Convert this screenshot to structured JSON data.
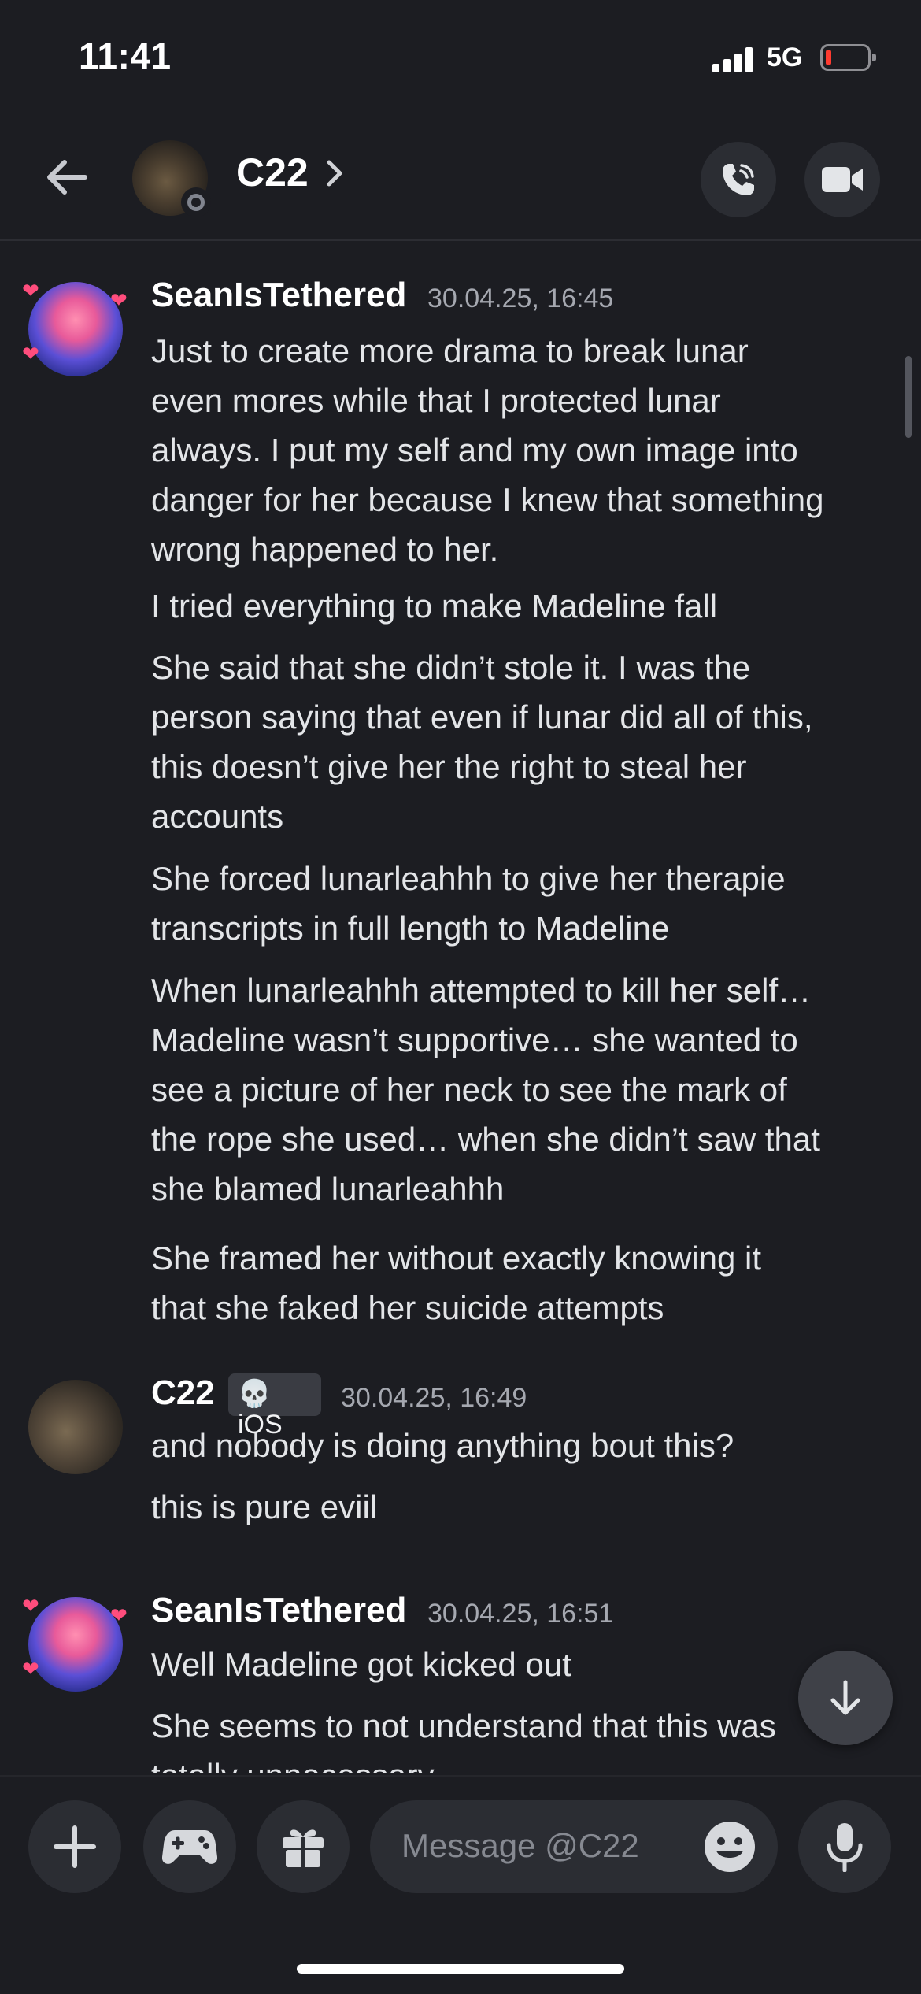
{
  "status_bar": {
    "time": "11:41",
    "network": "5G"
  },
  "header": {
    "contact_name": "C22"
  },
  "messages": [
    {
      "author": "SeanIsTethered",
      "timestamp": "30.04.25, 16:45",
      "lines": [
        "Just to create more drama to break lunar\neven mores while that I protected lunar\nalways. I put my self and my own image into\ndanger for her because I knew that something\nwrong happened to her.",
        "I tried everything to make Madeline fall",
        "She said that she didn’t stole it. I was the\nperson saying that even if lunar did all of this,\nthis doesn’t give her the right to steal her\naccounts",
        "She forced lunarleahhh to give her therapie\ntranscripts in full length to Madeline",
        "When lunarleahhh attempted to kill her self…\nMadeline wasn’t supportive… she wanted to\nsee a picture of her neck to see the mark of\nthe rope she used… when she didn’t saw that\nshe blamed lunarleahhh",
        "She framed her without exactly knowing it\nthat she faked her suicide attempts"
      ]
    },
    {
      "author": "C22",
      "tag": "iOS",
      "timestamp": "30.04.25, 16:49",
      "lines": [
        "and nobody is doing anything bout this?",
        "this is pure eviil"
      ]
    },
    {
      "author": "SeanIsTethered",
      "timestamp": "30.04.25, 16:51",
      "lines": [
        "Well Madeline got kicked out",
        "She seems to not understand that this was\ntotally unnecessary"
      ]
    }
  ],
  "composer": {
    "placeholder": "Message @C22"
  },
  "colors": {
    "background": "#1c1d22",
    "button": "#2b2d33",
    "text": "#e3e5e8",
    "timestamp": "#a5a8b0"
  },
  "icons": [
    "back-arrow-icon",
    "chevron-right-icon",
    "phone-icon",
    "video-camera-icon",
    "arrow-down-icon",
    "plus-icon",
    "gamepad-icon",
    "gift-icon",
    "emoji-icon",
    "microphone-icon"
  ]
}
